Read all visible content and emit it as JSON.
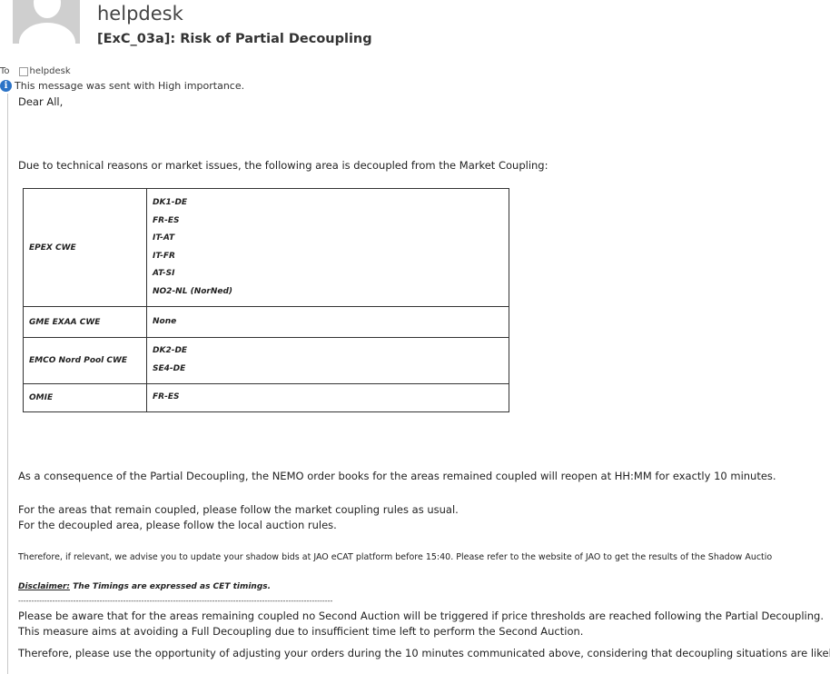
{
  "header": {
    "sender": "helpdesk",
    "subject": "[ExC_03a]: Risk of Partial Decoupling",
    "to_label": "To",
    "to_value": "helpdesk",
    "importance": "This message was sent with High importance."
  },
  "body": {
    "greeting": "Dear All,",
    "intro": "Due to technical reasons or market issues, the following area is decoupled from the Market Coupling:",
    "table": [
      {
        "market": "EPEX CWE",
        "areas": [
          "DK1-DE",
          "FR-ES",
          "IT-AT",
          "IT-FR",
          "AT-SI",
          "NO2-NL (NorNed)"
        ]
      },
      {
        "market": "GME EXAA CWE",
        "areas": [
          "None"
        ]
      },
      {
        "market": "EMCO Nord Pool CWE",
        "areas": [
          "DK2-DE",
          "SE4-DE"
        ]
      },
      {
        "market": "OMIE",
        "areas": [
          "FR-ES"
        ]
      }
    ],
    "consequence": "As a consequence of the Partial Decoupling, the NEMO order books for the areas remained coupled will reopen at HH:MM for exactly 10 minutes.",
    "coupled_rules": "For the areas that remain coupled, please follow the market coupling rules as usual.",
    "decoupled_rules": "For the decoupled area, please follow the local auction rules.",
    "shadow_note": "Therefore, if relevant, we advise you to update your shadow bids at JAO eCAT platform before 15:40. Please refer to the website of JAO to get the results of the Shadow Auctio",
    "disclaimer_label": "Disclaimer:",
    "disclaimer_text": " The Timings are expressed as CET timings.",
    "separator": "------------------------------------------------------------------------------------------------------------------------",
    "aware": "Please be aware that for the areas remaining coupled no Second Auction will be triggered if price thresholds are reached following the Partial Decoupling.",
    "measure": "This measure aims at avoiding a Full Decoupling due to insufficient time left to perform the Second Auction.",
    "opportunity": "Therefore, please use the opportunity of adjusting your orders during the 10 minutes communicated above, considering that decoupling situations are likely to"
  },
  "icons": {
    "avatar": "person-placeholder-icon",
    "importance": "info-icon"
  },
  "colors": {
    "info_icon": "#2b73c7",
    "avatar_bg": "#cfcfcf"
  }
}
